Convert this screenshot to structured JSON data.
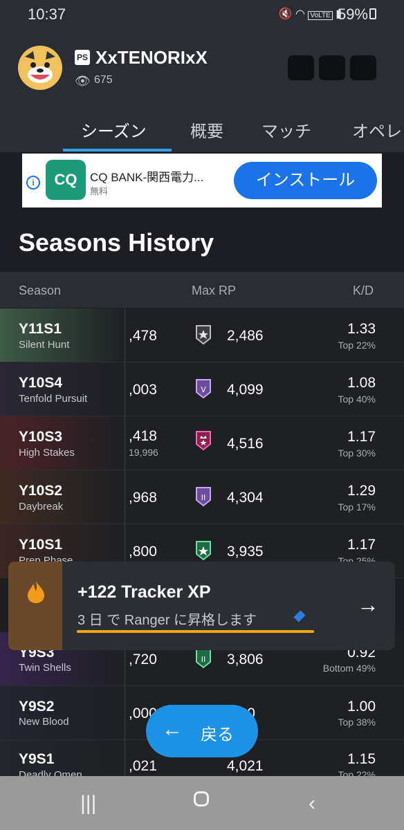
{
  "status": {
    "time": "10:37",
    "battery": "59%",
    "net": "VoLTE"
  },
  "header": {
    "platform_icon": "playstation-icon",
    "username": "XxTENORIxX",
    "views": "675",
    "tabs": [
      {
        "label": "シーズン",
        "active": true
      },
      {
        "label": "概要",
        "active": false
      },
      {
        "label": "マッチ",
        "active": false
      },
      {
        "label": "オペレ",
        "active": false
      }
    ]
  },
  "ad": {
    "logo_text": "CQ",
    "title": "CQ BANK-関西電力...",
    "sub": "無料",
    "button": "インストール"
  },
  "section": {
    "title": "Seasons History",
    "columns": {
      "season": "Season",
      "maxrp": "Max RP",
      "kd": "K/D"
    }
  },
  "rows": [
    {
      "code": "Y11S1",
      "name": "Silent Hunt",
      "mmr": ",478",
      "mmr2": "",
      "rp": "2,486",
      "kd": "1.33",
      "pct": "Top 22%"
    },
    {
      "code": "Y10S4",
      "name": "Tenfold Pursuit",
      "mmr": ",003",
      "mmr2": "",
      "rp": "4,099",
      "kd": "1.08",
      "pct": "Top 40%"
    },
    {
      "code": "Y10S3",
      "name": "High Stakes",
      "mmr": ",418",
      "mmr2": "19,996",
      "rp": "4,516",
      "kd": "1.17",
      "pct": "Top 30%"
    },
    {
      "code": "Y10S2",
      "name": "Daybreak",
      "mmr": ",968",
      "mmr2": "",
      "rp": "4,304",
      "kd": "1.29",
      "pct": "Top 17%"
    },
    {
      "code": "Y10S1",
      "name": "Prep Phase",
      "mmr": ",800",
      "mmr2": "",
      "rp": "3,935",
      "kd": "1.17",
      "pct": "Top 25%"
    },
    {
      "code": "Y9S3",
      "name": "Twin Shells",
      "mmr": ",720",
      "mmr2": "",
      "rp": "3,806",
      "kd": "0.92",
      "pct": "Bottom 49%"
    },
    {
      "code": "Y9S2",
      "name": "New Blood",
      "mmr": ",000",
      "mmr2": "",
      "rp": ",000",
      "kd": "1.00",
      "pct": "Top 38%"
    },
    {
      "code": "Y9S1",
      "name": "Deadly Omen",
      "mmr": ",021",
      "mmr2": "",
      "rp": "4,021",
      "kd": "1.15",
      "pct": "Top 22%"
    }
  ],
  "tracker": {
    "title": "+122 Tracker XP",
    "sub": "3 日 で Ranger に昇格します"
  },
  "back_button": "戻る"
}
